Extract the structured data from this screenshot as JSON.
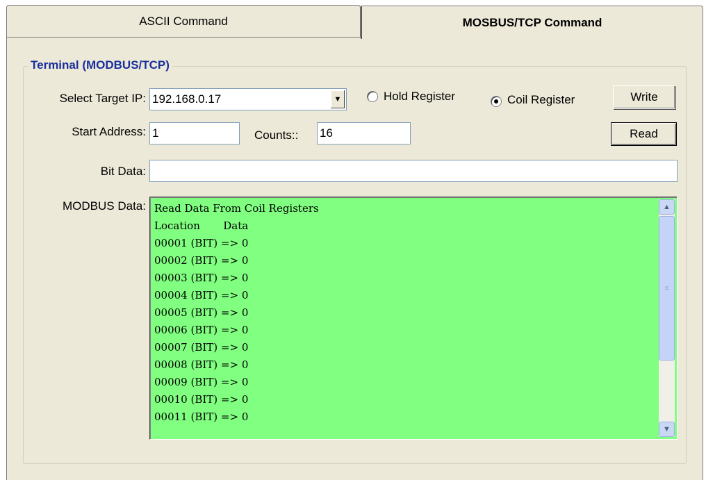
{
  "tabs": [
    {
      "label": "ASCII Command",
      "active": false
    },
    {
      "label": "MOSBUS/TCP Command",
      "active": true
    }
  ],
  "group": {
    "title": "Terminal (MODBUS/TCP)"
  },
  "form": {
    "target_ip_label": "Select Target IP:",
    "target_ip_value": "192.168.0.17",
    "hold_register_label": "Hold Register",
    "coil_register_label": "Coil Register",
    "selected_register": "coil",
    "write_label": "Write",
    "read_label": "Read",
    "start_address_label": "Start Address:",
    "start_address_value": "1",
    "counts_label": "Counts::",
    "counts_value": "16",
    "bit_data_label": "Bit Data:",
    "bit_data_value": "",
    "modbus_data_label": "MODBUS Data:"
  },
  "modbus_output": {
    "lines": [
      "Read Data From Coil Registers",
      "Location       Data",
      "00001 (BIT) => 0",
      "00002 (BIT) => 0",
      "00003 (BIT) => 0",
      "00004 (BIT) => 0",
      "00005 (BIT) => 0",
      "00006 (BIT) => 0",
      "00007 (BIT) => 0",
      "00008 (BIT) => 0",
      "00009 (BIT) => 0",
      "00010 (BIT) => 0",
      "00011 (BIT) => 0"
    ],
    "background_color": "#80ff80"
  },
  "icons": {
    "dropdown": "chevron-down-icon",
    "scroll_up": "arrow-up-icon",
    "scroll_down": "arrow-down-icon"
  },
  "colors": {
    "group_title": "#1a2f9e",
    "panel": "#ece9d8"
  }
}
